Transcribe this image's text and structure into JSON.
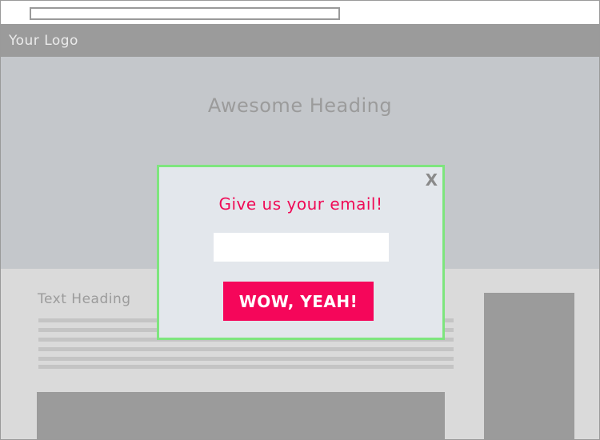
{
  "header": {
    "logo_text": "Your Logo"
  },
  "hero": {
    "heading": "Awesome Heading"
  },
  "content": {
    "text_heading": "Text Heading"
  },
  "modal": {
    "close_label": "X",
    "title": "Give us your email!",
    "email_value": "",
    "submit_label": "WOW, YEAH!"
  },
  "colors": {
    "accent": "#f5065a",
    "modal_border": "#7ee57e",
    "header_bg": "#9b9b9b",
    "hero_bg": "#c4c7cb",
    "modal_bg": "#e3e7ec"
  }
}
